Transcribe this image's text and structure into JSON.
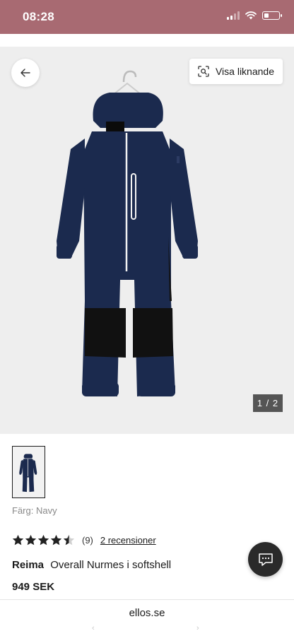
{
  "status_bar": {
    "time": "08:28",
    "battery_level": 0.35,
    "background_color": "#a86a72"
  },
  "gallery": {
    "similar_button_label": "Visa liknande",
    "pager_text": "1 / 2",
    "back_icon": "arrow-left-icon",
    "similar_icon": "visual-search-icon"
  },
  "product": {
    "color_label": "Färg:",
    "color_value": "Navy",
    "rating_value": 4.5,
    "rating_count": "(9)",
    "reviews_link": "2 recensioner",
    "brand": "Reima",
    "name": "Overall Nurmes i softshell",
    "price": "949 SEK",
    "garment_color": "#1b2a4e",
    "panel_color": "#111111"
  },
  "browser": {
    "url": "ellos.se",
    "back_glyph": "‹",
    "forward_glyph": "›"
  },
  "chat": {
    "icon": "chat-bubble-icon"
  }
}
